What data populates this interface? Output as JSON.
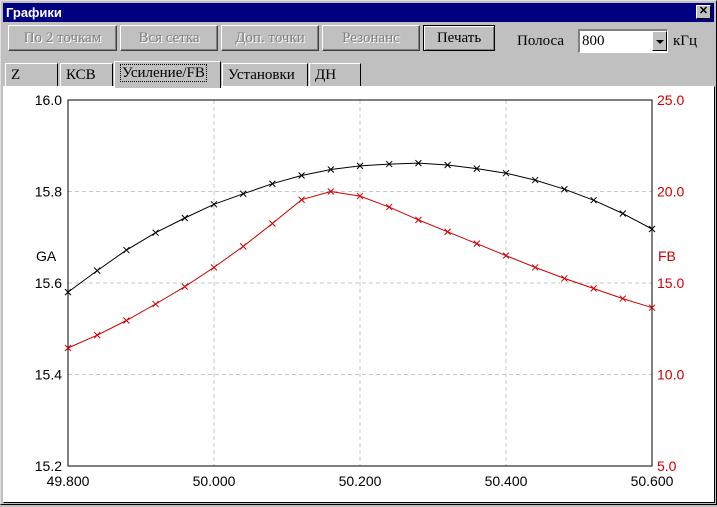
{
  "window": {
    "title": "Графики",
    "close_symbol": "✕"
  },
  "toolbar": {
    "buttons": [
      {
        "label": "По 2 точкам",
        "enabled": false
      },
      {
        "label": "Вся сетка",
        "enabled": false
      },
      {
        "label": "Доп. точки",
        "enabled": false
      },
      {
        "label": "Резонанс",
        "enabled": false
      },
      {
        "label": "Печать",
        "enabled": true
      }
    ],
    "band_label": "Полоса",
    "band_value": "800",
    "band_unit": "кГц"
  },
  "tabs": [
    {
      "label": "Z",
      "active": false
    },
    {
      "label": "КСВ",
      "active": false
    },
    {
      "label": "Усиление/FB",
      "active": true
    },
    {
      "label": "Установки",
      "active": false
    },
    {
      "label": "ДН",
      "active": false
    }
  ],
  "chart_data": {
    "type": "line",
    "grid": true,
    "xlim": [
      49.8,
      50.6
    ],
    "x_ticks": [
      "49.800",
      "50.000",
      "50.200",
      "50.400",
      "50.600"
    ],
    "x_tick_values": [
      49.8,
      50.0,
      50.2,
      50.4,
      50.6
    ],
    "y_left": {
      "label": "GA",
      "lim": [
        15.2,
        16.0
      ],
      "ticks": [
        "15.2",
        "15.4",
        "15.6",
        "15.8",
        "16.0"
      ],
      "tick_values": [
        15.2,
        15.4,
        15.6,
        15.8,
        16.0
      ],
      "color": "#000000"
    },
    "y_right": {
      "label": "FB",
      "lim": [
        5.0,
        25.0
      ],
      "ticks": [
        "5.0",
        "10.0",
        "15.0",
        "20.0",
        "25.0"
      ],
      "tick_values": [
        5.0,
        10.0,
        15.0,
        20.0,
        25.0
      ],
      "color": "#cc0000"
    },
    "series": [
      {
        "axis": "left",
        "color": "#000000",
        "x": [
          49.8,
          49.84,
          49.88,
          49.92,
          49.96,
          50.0,
          50.04,
          50.08,
          50.12,
          50.16,
          50.2,
          50.24,
          50.28,
          50.32,
          50.36,
          50.4,
          50.44,
          50.48,
          50.52,
          50.56,
          50.6
        ],
        "y": [
          15.58,
          15.627,
          15.672,
          15.71,
          15.742,
          15.772,
          15.795,
          15.817,
          15.835,
          15.848,
          15.856,
          15.86,
          15.862,
          15.858,
          15.85,
          15.84,
          15.825,
          15.805,
          15.781,
          15.752,
          15.718
        ]
      },
      {
        "axis": "right",
        "color": "#cc0000",
        "x": [
          49.8,
          49.84,
          49.88,
          49.92,
          49.96,
          50.0,
          50.04,
          50.08,
          50.12,
          50.16,
          50.2,
          50.24,
          50.28,
          50.32,
          50.36,
          50.4,
          50.44,
          50.48,
          50.52,
          50.56,
          50.6
        ],
        "y": [
          11.45,
          12.15,
          12.95,
          13.85,
          14.8,
          15.85,
          17.0,
          18.25,
          19.55,
          20.0,
          19.75,
          19.15,
          18.45,
          17.8,
          17.15,
          16.5,
          15.85,
          15.25,
          14.7,
          14.15,
          13.65
        ]
      }
    ]
  }
}
